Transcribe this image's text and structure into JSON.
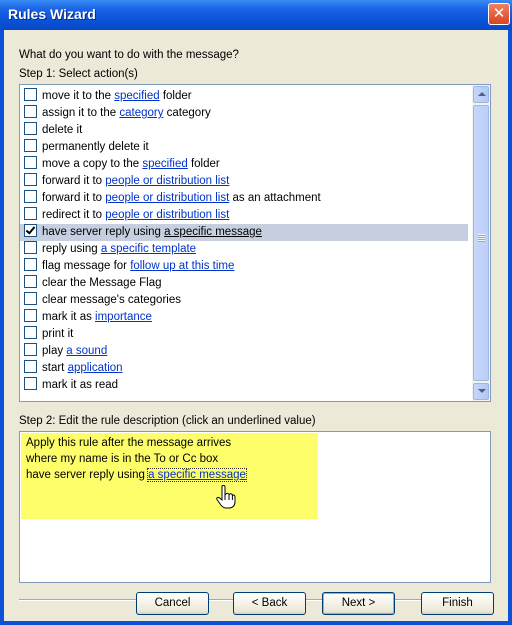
{
  "window": {
    "title": "Rules Wizard",
    "close_glyph": "✕"
  },
  "question": "What do you want to do with the message?",
  "step1_label": "Step 1: Select action(s)",
  "step2_label": "Step 2: Edit the rule description (click an underlined value)",
  "actions": [
    {
      "checked": false,
      "selected": false,
      "before": "move it to the ",
      "link": "specified",
      "after": " folder"
    },
    {
      "checked": false,
      "selected": false,
      "before": "assign it to the ",
      "link": "category",
      "after": " category"
    },
    {
      "checked": false,
      "selected": false,
      "before": "delete it",
      "link": "",
      "after": ""
    },
    {
      "checked": false,
      "selected": false,
      "before": "permanently delete it",
      "link": "",
      "after": ""
    },
    {
      "checked": false,
      "selected": false,
      "before": "move a copy to the ",
      "link": "specified",
      "after": " folder"
    },
    {
      "checked": false,
      "selected": false,
      "before": "forward it to ",
      "link": "people or distribution list",
      "after": ""
    },
    {
      "checked": false,
      "selected": false,
      "before": "forward it to ",
      "link": "people or distribution list",
      "after": " as an attachment"
    },
    {
      "checked": false,
      "selected": false,
      "before": "redirect it to ",
      "link": "people or distribution list",
      "after": ""
    },
    {
      "checked": true,
      "selected": true,
      "before": "have server reply using ",
      "link": "a specific message",
      "after": ""
    },
    {
      "checked": false,
      "selected": false,
      "before": "reply using ",
      "link": "a specific template",
      "after": ""
    },
    {
      "checked": false,
      "selected": false,
      "before": "flag message for ",
      "link": "follow up at this time",
      "after": ""
    },
    {
      "checked": false,
      "selected": false,
      "before": "clear the Message Flag",
      "link": "",
      "after": ""
    },
    {
      "checked": false,
      "selected": false,
      "before": "clear message's categories",
      "link": "",
      "after": ""
    },
    {
      "checked": false,
      "selected": false,
      "before": "mark it as ",
      "link": "importance",
      "after": ""
    },
    {
      "checked": false,
      "selected": false,
      "before": "print it",
      "link": "",
      "after": ""
    },
    {
      "checked": false,
      "selected": false,
      "before": "play ",
      "link": "a sound",
      "after": ""
    },
    {
      "checked": false,
      "selected": false,
      "before": "start ",
      "link": "application",
      "after": ""
    },
    {
      "checked": false,
      "selected": false,
      "before": "mark it as read",
      "link": "",
      "after": ""
    }
  ],
  "description": {
    "line1": "Apply this rule after the message arrives",
    "line2": "where my name is in the To or Cc box",
    "line3_prefix": "have server reply using ",
    "line3_link": "a specific message"
  },
  "buttons": {
    "cancel": "Cancel",
    "back": "< Back",
    "next": "Next >",
    "finish": "Finish"
  },
  "colors": {
    "titlebar": "#0b52d6",
    "dialog_bg": "#ece9d8",
    "link": "#0033cc",
    "description_highlight": "#fefe6b"
  }
}
